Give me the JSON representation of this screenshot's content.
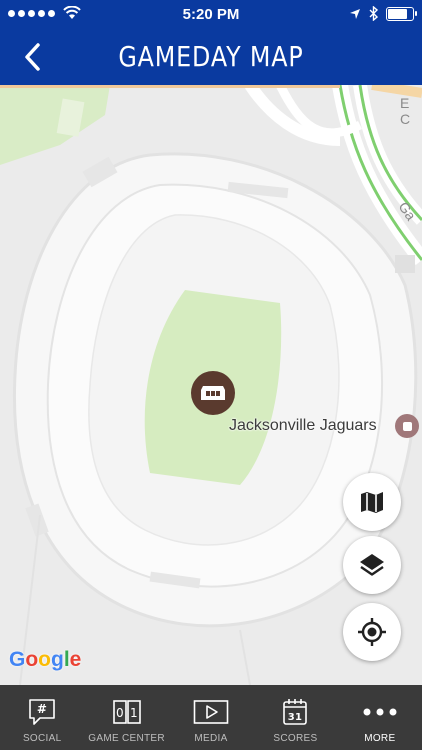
{
  "status_bar": {
    "time": "5:20 PM",
    "battery_level": 0.85
  },
  "header": {
    "title": "GAMEDAY MAP"
  },
  "map": {
    "place_label": "Jacksonville Jaguars",
    "road_labels": [
      "E C",
      "Ga"
    ],
    "attribution": {
      "letters": [
        "G",
        "o",
        "o",
        "g",
        "l",
        "e"
      ],
      "colors": [
        "#4285F4",
        "#EA4335",
        "#FBBC05",
        "#4285F4",
        "#34A853",
        "#EA4335"
      ]
    },
    "field_color": "#d6ecc0",
    "marker_color": "#5a3a2e"
  },
  "tabs": [
    {
      "label": "SOCIAL",
      "icon": "hashtag-bubble-icon"
    },
    {
      "label": "GAME CENTER",
      "icon": "scoreboard-icon"
    },
    {
      "label": "MEDIA",
      "icon": "play-icon"
    },
    {
      "label": "SCORES",
      "icon": "calendar-icon",
      "badge": "31"
    },
    {
      "label": "MORE",
      "icon": "more-dots-icon",
      "active": true
    }
  ],
  "colors": {
    "header_bg": "#0a3aa0",
    "tabbar_bg": "#3a3a3a"
  }
}
